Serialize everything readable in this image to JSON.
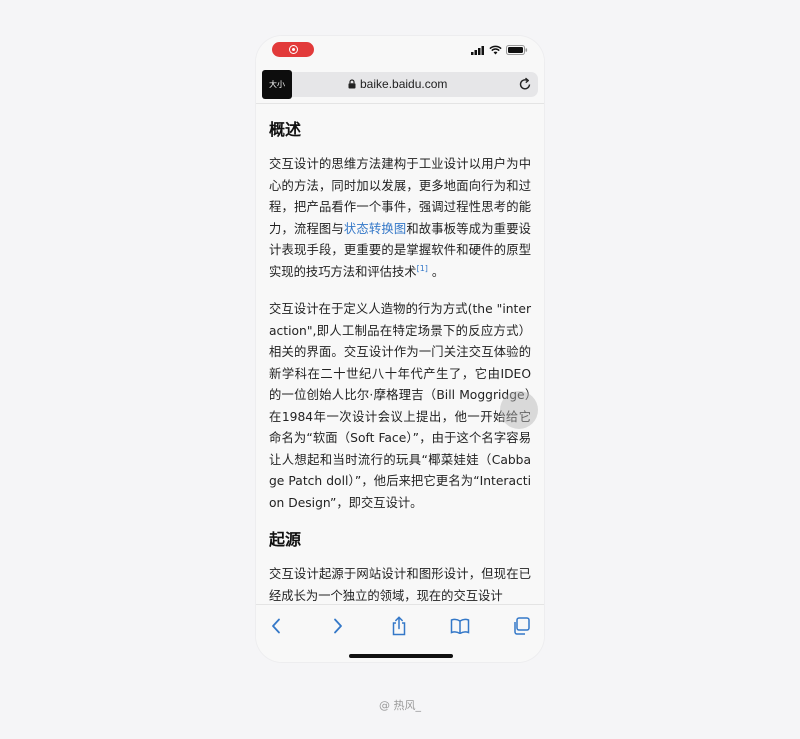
{
  "colors": {
    "accent": "#3478c8",
    "record": "#e23a3a"
  },
  "status_bar": {
    "recording_icon": "screen-record-icon",
    "icons": [
      "cellular-signal-icon",
      "wifi-icon",
      "battery-icon"
    ]
  },
  "url_bar": {
    "size_button_label": "大小",
    "lock_icon": "lock-icon",
    "url": "baike.baidu.com",
    "reload_icon": "reload-icon"
  },
  "article": {
    "section1_heading": "概述",
    "p1_before_link": "交互设计的思维方法建构于工业设计以用户为中心的方法，同时加以发展，更多地面向行为和过程，把产品看作一个事件，强调过程性思考的能力，流程图与",
    "p1_link": "状态转换图",
    "p1_after_link": "和故事板等成为重要设计表现手段，更重要的是掌握软件和硬件的原型实现的技巧方法和评估技术",
    "p1_ref": "[1]",
    "p1_end": " 。",
    "p2": "交互设计在于定义人造物的行为方式(the \"interaction\",即人工制品在特定场景下的反应方式）相关的界面。交互设计作为一门关注交互体验的新学科在二十世纪八十年代产生了，它由IDEO的一位创始人比尔·摩格理吉（Bill Moggridge）在1984年一次设计会议上提出，他一开始给它命名为“软面（Soft Face）”，由于这个名字容易让人想起和当时流行的玩具“椰菜娃娃（Cabbage Patch doll）”，他后来把它更名为“Interaction Design”，即交互设计。",
    "section2_heading": "起源",
    "p3": "交互设计起源于网站设计和图形设计，但现在已经成长为一个独立的领域，现在的交互设计"
  },
  "toolbar": {
    "back_icon": "chevron-left-icon",
    "forward_icon": "chevron-right-icon",
    "share_icon": "share-icon",
    "bookmarks_icon": "book-icon",
    "tabs_icon": "tabs-icon"
  },
  "credit": "@ 热风_"
}
